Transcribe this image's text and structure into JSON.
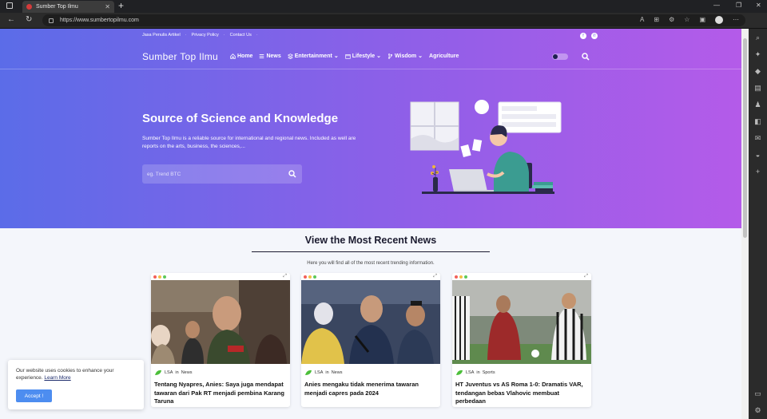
{
  "browser": {
    "tab_title": "Sumber Top Ilmu",
    "url": "https://www.sumbertopilmu.com"
  },
  "site": {
    "top_links": [
      "Jasa Penulis Artikel",
      "Privacy Policy",
      "Contact Us"
    ],
    "brand": "Sumber Top Ilmu",
    "nav": [
      {
        "label": "Home",
        "icon": "home-icon"
      },
      {
        "label": "News",
        "icon": "list-icon"
      },
      {
        "label": "Entertainment",
        "icon": "layers-icon",
        "dropdown": true
      },
      {
        "label": "Lifestyle",
        "icon": "calendar-icon",
        "dropdown": true
      },
      {
        "label": "Wisdom",
        "icon": "branch-icon",
        "dropdown": true
      },
      {
        "label": "Agriculture"
      }
    ]
  },
  "hero": {
    "title": "Source of Science and Knowledge",
    "description": "Sumber Top Ilmu is a reliable source for international and regional news. Included as well are reports on the arts, business, the sciences,...",
    "search_placeholder": "eg. Trend BTC"
  },
  "recent": {
    "title": "View the Most Recent News",
    "subtitle": "Here you will find all of the most recent trending information.",
    "cards": [
      {
        "author": "LSA",
        "in": "in",
        "category": "News",
        "headline": "Tentang Nyapres, Anies: Saya juga mendapat tawaran dari Pak RT menjadi pembina Karang Taruna"
      },
      {
        "author": "LSA",
        "in": "in",
        "category": "News",
        "headline": "Anies mengaku tidak menerima tawaran menjadi capres pada 2024"
      },
      {
        "author": "LSA",
        "in": "in",
        "category": "Sports",
        "headline": "HT Juventus vs AS Roma 1-0: Dramatis VAR, tendangan bebas Vlahovic membuat perbedaan"
      }
    ]
  },
  "cookie": {
    "message": "Our website uses cookies to enhance your experience.",
    "learn_more": "Learn More",
    "accept": "Accept !"
  },
  "colors": {
    "hero_start": "#5b6ce8",
    "hero_end": "#b45be9",
    "accept_button": "#4d8df0"
  }
}
